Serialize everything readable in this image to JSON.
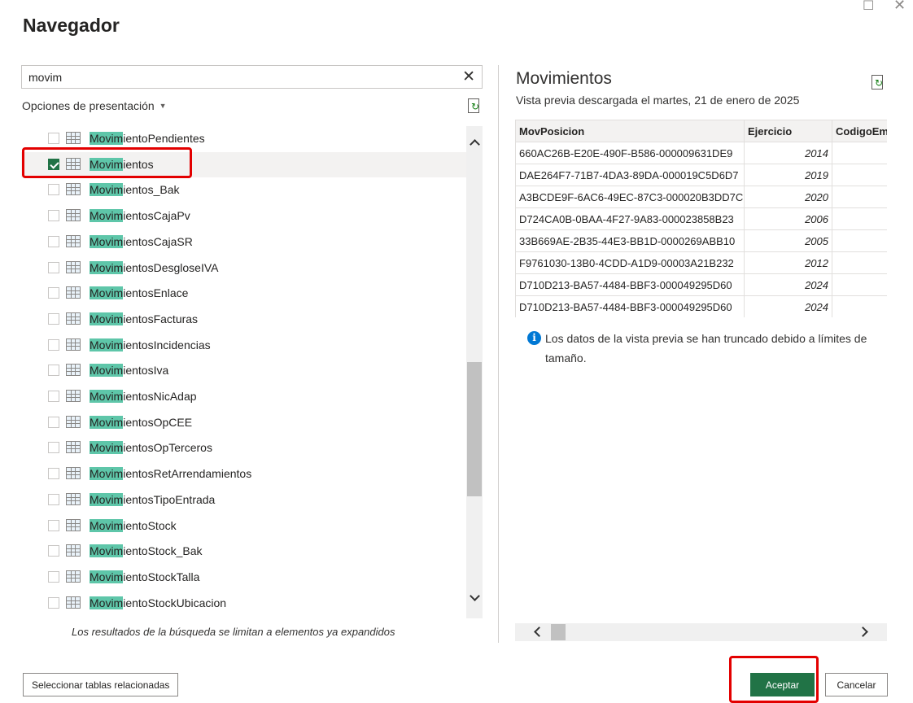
{
  "window": {
    "title": "Navegador",
    "maximize_glyph": "☐",
    "close_glyph": "✕"
  },
  "search": {
    "value": "movim",
    "clear_glyph": "✕",
    "clear_icon": "close-icon"
  },
  "options_label": "Opciones de presentación",
  "caret_glyph": "▼",
  "list": {
    "items": [
      {
        "match": "Movim",
        "rest": "ientoPendientes",
        "checked": false
      },
      {
        "match": "Movim",
        "rest": "ientos",
        "checked": true
      },
      {
        "match": "Movim",
        "rest": "ientos_Bak",
        "checked": false
      },
      {
        "match": "Movim",
        "rest": "ientosCajaPv",
        "checked": false
      },
      {
        "match": "Movim",
        "rest": "ientosCajaSR",
        "checked": false
      },
      {
        "match": "Movim",
        "rest": "ientosDesgloseIVA",
        "checked": false
      },
      {
        "match": "Movim",
        "rest": "ientosEnlace",
        "checked": false
      },
      {
        "match": "Movim",
        "rest": "ientosFacturas",
        "checked": false
      },
      {
        "match": "Movim",
        "rest": "ientosIncidencias",
        "checked": false
      },
      {
        "match": "Movim",
        "rest": "ientosIva",
        "checked": false
      },
      {
        "match": "Movim",
        "rest": "ientosNicAdap",
        "checked": false
      },
      {
        "match": "Movim",
        "rest": "ientosOpCEE",
        "checked": false
      },
      {
        "match": "Movim",
        "rest": "ientosOpTerceros",
        "checked": false
      },
      {
        "match": "Movim",
        "rest": "ientosRetArrendamientos",
        "checked": false
      },
      {
        "match": "Movim",
        "rest": "ientosTipoEntrada",
        "checked": false
      },
      {
        "match": "Movim",
        "rest": "ientoStock",
        "checked": false
      },
      {
        "match": "Movim",
        "rest": "ientoStock_Bak",
        "checked": false
      },
      {
        "match": "Movim",
        "rest": "ientoStockTalla",
        "checked": false
      },
      {
        "match": "Movim",
        "rest": "ientoStockUbicacion",
        "checked": false
      }
    ],
    "note": "Los resultados de la búsqueda se limitan a elementos ya expandidos"
  },
  "preview": {
    "title": "Movimientos",
    "subtitle": "Vista previa descargada el martes, 21 de enero de 2025",
    "columns": [
      "MovPosicion",
      "Ejercicio",
      "CodigoEmpresa"
    ],
    "rows": [
      [
        "660AC26B-E20E-490F-B586-000009631DE9",
        "2014",
        ""
      ],
      [
        "DAE264F7-71B7-4DA3-89DA-000019C5D6D7",
        "2019",
        ""
      ],
      [
        "A3BCDE9F-6AC6-49EC-87C3-000020B3DD7C",
        "2020",
        ""
      ],
      [
        "D724CA0B-0BAA-4F27-9A83-000023858B23",
        "2006",
        ""
      ],
      [
        "33B669AE-2B35-44E3-BB1D-0000269ABB10",
        "2005",
        ""
      ],
      [
        "F9761030-13B0-4CDD-A1D9-00003A21B232",
        "2012",
        ""
      ],
      [
        "D710D213-BA57-4484-BBF3-000049295D60",
        "2024",
        ""
      ],
      [
        "D710D213-BA57-4484-BBF3-000049295D60",
        "2024",
        ""
      ]
    ],
    "info_glyph": "i",
    "info": "Los datos de la vista previa se han truncado debido a límites de tamaño."
  },
  "buttons": {
    "related": "Seleccionar tablas relacionadas",
    "accept": "Aceptar",
    "cancel": "Cancelar"
  },
  "colors": {
    "accent": "#217346",
    "highlight": "#5ec6a9",
    "annotation": "#e30000",
    "info": "#0078d4"
  }
}
